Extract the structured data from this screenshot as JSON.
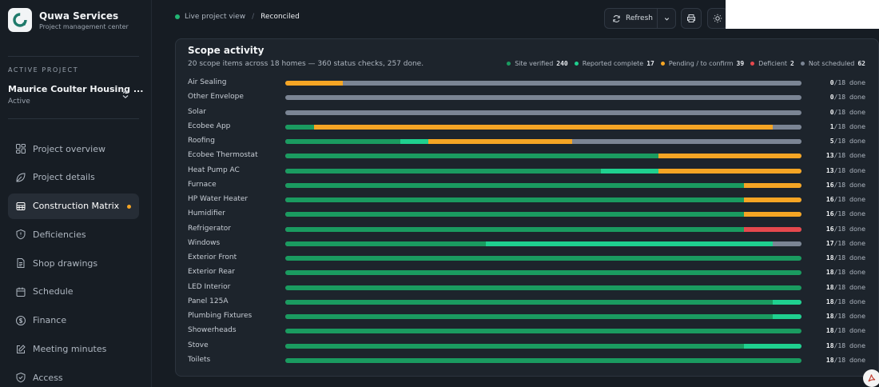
{
  "brand": {
    "name": "Quwa Services",
    "subtitle": "Project management center"
  },
  "active_project": {
    "label": "ACTIVE PROJECT",
    "name": "Maurice Coulter Housing ...",
    "status": "Active"
  },
  "nav": [
    {
      "label": "Project overview",
      "icon": "grid-icon"
    },
    {
      "label": "Project details",
      "icon": "leaf-icon"
    },
    {
      "label": "Construction Matrix",
      "icon": "layers-icon",
      "active": true,
      "has_dot": true
    },
    {
      "label": "Deficiencies",
      "icon": "shield-alert-icon"
    },
    {
      "label": "Shop drawings",
      "icon": "document-icon"
    },
    {
      "label": "Schedule",
      "icon": "calendar-icon"
    },
    {
      "label": "Finance",
      "icon": "dollar-icon"
    },
    {
      "label": "Meeting minutes",
      "icon": "edit-icon"
    },
    {
      "label": "Access",
      "icon": "shield-check-icon"
    }
  ],
  "topbar": {
    "live_label": "Live project view",
    "separator": "/",
    "reconciled_label": "Reconciled",
    "refresh_label": "Refresh"
  },
  "scope": {
    "title": "Scope activity",
    "subtitle": "20 scope items across 18 homes — 360 status checks, 257 done.",
    "legend": [
      {
        "label": "Site verified",
        "count": "240",
        "color": "#1a9b60"
      },
      {
        "label": "Reported complete",
        "count": "17",
        "color": "#1fd08f"
      },
      {
        "label": "Pending / to confirm",
        "count": "39",
        "color": "#f5a524"
      },
      {
        "label": "Deficient",
        "count": "2",
        "color": "#e5484d"
      },
      {
        "label": "Not scheduled",
        "count": "62",
        "color": "#7b8594"
      }
    ],
    "total": 18,
    "done_label": "done",
    "items": [
      {
        "name": "Air Sealing",
        "done": "0",
        "verified": 0,
        "reported": 0,
        "pending": 2,
        "deficient": 0,
        "not_scheduled": 16
      },
      {
        "name": "Other Envelope",
        "done": "0",
        "verified": 0,
        "reported": 0,
        "pending": 0,
        "deficient": 0,
        "not_scheduled": 18
      },
      {
        "name": "Solar",
        "done": "0",
        "verified": 0,
        "reported": 0,
        "pending": 0,
        "deficient": 0,
        "not_scheduled": 18
      },
      {
        "name": "Ecobee App",
        "done": "1",
        "verified": 1,
        "reported": 0,
        "pending": 16,
        "deficient": 0,
        "not_scheduled": 1
      },
      {
        "name": "Roofing",
        "done": "5",
        "verified": 4,
        "reported": 1,
        "pending": 5,
        "deficient": 0,
        "not_scheduled": 8
      },
      {
        "name": "Ecobee Thermostat",
        "done": "13",
        "verified": 13,
        "reported": 0,
        "pending": 5,
        "deficient": 0,
        "not_scheduled": 0
      },
      {
        "name": "Heat Pump AC",
        "done": "13",
        "verified": 11,
        "reported": 2,
        "pending": 5,
        "deficient": 0,
        "not_scheduled": 0
      },
      {
        "name": "Furnace",
        "done": "16",
        "verified": 16,
        "reported": 0,
        "pending": 2,
        "deficient": 0,
        "not_scheduled": 0
      },
      {
        "name": "HP Water Heater",
        "done": "16",
        "verified": 16,
        "reported": 0,
        "pending": 2,
        "deficient": 0,
        "not_scheduled": 0
      },
      {
        "name": "Humidifier",
        "done": "16",
        "verified": 16,
        "reported": 0,
        "pending": 2,
        "deficient": 0,
        "not_scheduled": 0
      },
      {
        "name": "Refrigerator",
        "done": "16",
        "verified": 16,
        "reported": 0,
        "pending": 0,
        "deficient": 2,
        "not_scheduled": 0
      },
      {
        "name": "Windows",
        "done": "17",
        "verified": 7,
        "reported": 10,
        "pending": 0,
        "deficient": 0,
        "not_scheduled": 1
      },
      {
        "name": "Exterior Front",
        "done": "18",
        "verified": 18,
        "reported": 0,
        "pending": 0,
        "deficient": 0,
        "not_scheduled": 0
      },
      {
        "name": "Exterior Rear",
        "done": "18",
        "verified": 18,
        "reported": 0,
        "pending": 0,
        "deficient": 0,
        "not_scheduled": 0
      },
      {
        "name": "LED Interior",
        "done": "18",
        "verified": 18,
        "reported": 0,
        "pending": 0,
        "deficient": 0,
        "not_scheduled": 0
      },
      {
        "name": "Panel 125A",
        "done": "18",
        "verified": 17,
        "reported": 1,
        "pending": 0,
        "deficient": 0,
        "not_scheduled": 0
      },
      {
        "name": "Plumbing Fixtures",
        "done": "18",
        "verified": 17,
        "reported": 1,
        "pending": 0,
        "deficient": 0,
        "not_scheduled": 0
      },
      {
        "name": "Showerheads",
        "done": "18",
        "verified": 18,
        "reported": 0,
        "pending": 0,
        "deficient": 0,
        "not_scheduled": 0
      },
      {
        "name": "Stove",
        "done": "18",
        "verified": 16,
        "reported": 2,
        "pending": 0,
        "deficient": 0,
        "not_scheduled": 0
      },
      {
        "name": "Toilets",
        "done": "18",
        "verified": 18,
        "reported": 0,
        "pending": 0,
        "deficient": 0,
        "not_scheduled": 0
      }
    ]
  }
}
